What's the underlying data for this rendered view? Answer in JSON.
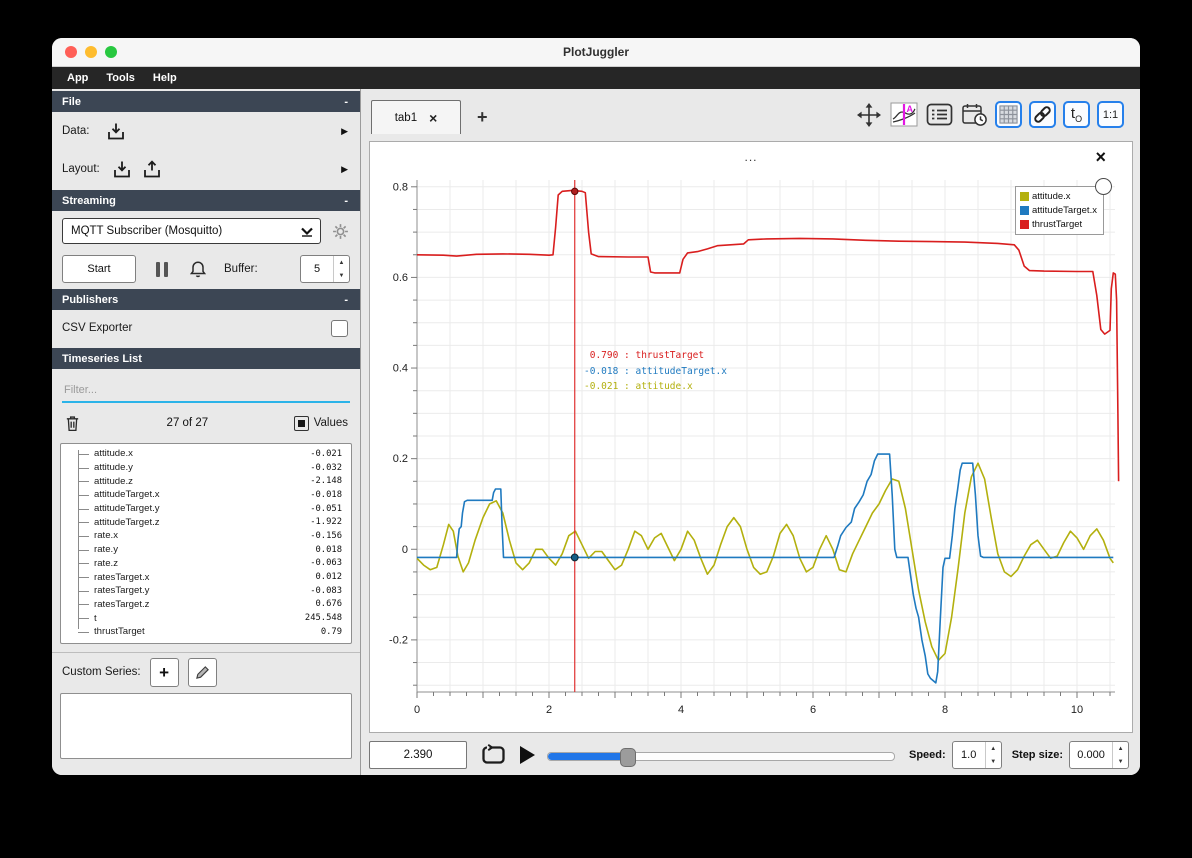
{
  "window": {
    "title": "PlotJuggler"
  },
  "menu": {
    "items": [
      "App",
      "Tools",
      "Help"
    ]
  },
  "sidebar": {
    "file": {
      "title": "File",
      "collapse": "-",
      "data_label": "Data:",
      "layout_label": "Layout:"
    },
    "streaming": {
      "title": "Streaming",
      "collapse": "-",
      "plugin_selected": "MQTT Subscriber (Mosquitto)",
      "start_button": "Start",
      "buffer_label": "Buffer:",
      "buffer_value": "5"
    },
    "publishers": {
      "title": "Publishers",
      "collapse": "-",
      "csv_exporter_label": "CSV Exporter"
    },
    "timeseries": {
      "title": "Timeseries List",
      "filter_placeholder": "Filter...",
      "count_text": "27 of 27",
      "values_label": "Values",
      "items": [
        {
          "name": "attitude.x",
          "value": "-0.021"
        },
        {
          "name": "attitude.y",
          "value": "-0.032"
        },
        {
          "name": "attitude.z",
          "value": "-2.148"
        },
        {
          "name": "attitudeTarget.x",
          "value": "-0.018"
        },
        {
          "name": "attitudeTarget.y",
          "value": "-0.051"
        },
        {
          "name": "attitudeTarget.z",
          "value": "-1.922"
        },
        {
          "name": "rate.x",
          "value": "-0.156"
        },
        {
          "name": "rate.y",
          "value": "0.018"
        },
        {
          "name": "rate.z",
          "value": "-0.063"
        },
        {
          "name": "ratesTarget.x",
          "value": "0.012"
        },
        {
          "name": "ratesTarget.y",
          "value": "-0.083"
        },
        {
          "name": "ratesTarget.z",
          "value": "0.676"
        },
        {
          "name": "t",
          "value": "245.548"
        },
        {
          "name": "thrustTarget",
          "value": "0.79"
        }
      ],
      "custom_series_label": "Custom Series:"
    }
  },
  "tabbar": {
    "active_tab": "tab1",
    "new_tab_label": "+",
    "icons": [
      "pan-zoom-icon",
      "trace-style-icon",
      "legend-list-icon",
      "datetime-icon",
      "grid-layout-icon",
      "link-axes-icon",
      "time-offset-icon",
      "ratio-1-1-icon"
    ],
    "ratio_text": "1:1"
  },
  "plot": {
    "title": "...",
    "tooltip": [
      {
        "value": "0.790",
        "series": "thrustTarget"
      },
      {
        "value": "-0.018",
        "series": "attitudeTarget.x"
      },
      {
        "value": "-0.021",
        "series": "attitude.x"
      }
    ]
  },
  "chart_data": {
    "type": "line",
    "title": "...",
    "xlabel": "",
    "ylabel": "",
    "xlim": [
      0,
      10.6
    ],
    "ylim": [
      -0.315,
      0.815
    ],
    "x_ticks": [
      0,
      2,
      4,
      6,
      8,
      10
    ],
    "y_ticks": [
      -0.2,
      0,
      0.2,
      0.4,
      0.6,
      0.8
    ],
    "grid": true,
    "legend_position": "top-right",
    "cursor": {
      "x": 2.39,
      "points": [
        {
          "series": "thrustTarget",
          "y": 0.79
        },
        {
          "series": "attitudeTarget.x",
          "y": -0.018
        }
      ]
    },
    "series": [
      {
        "name": "attitude.x",
        "color": "#b3b00e",
        "points": [
          [
            0,
            -0.02
          ],
          [
            0.1,
            -0.035
          ],
          [
            0.2,
            -0.045
          ],
          [
            0.3,
            -0.04
          ],
          [
            0.4,
            0.01
          ],
          [
            0.48,
            0.055
          ],
          [
            0.55,
            0.04
          ],
          [
            0.62,
            -0.015
          ],
          [
            0.7,
            -0.05
          ],
          [
            0.78,
            -0.03
          ],
          [
            0.88,
            0.02
          ],
          [
            1.0,
            0.07
          ],
          [
            1.1,
            0.1
          ],
          [
            1.2,
            0.107
          ],
          [
            1.3,
            0.08
          ],
          [
            1.4,
            0.02
          ],
          [
            1.5,
            -0.03
          ],
          [
            1.6,
            -0.045
          ],
          [
            1.7,
            -0.03
          ],
          [
            1.8,
            0.0
          ],
          [
            1.9,
            0.0
          ],
          [
            2.0,
            -0.02
          ],
          [
            2.1,
            -0.035
          ],
          [
            2.2,
            -0.01
          ],
          [
            2.3,
            0.03
          ],
          [
            2.4,
            0.04
          ],
          [
            2.5,
            0.01
          ],
          [
            2.6,
            -0.02
          ],
          [
            2.7,
            -0.005
          ],
          [
            2.8,
            -0.005
          ],
          [
            2.9,
            -0.025
          ],
          [
            3.0,
            -0.045
          ],
          [
            3.1,
            -0.035
          ],
          [
            3.2,
            0.0
          ],
          [
            3.3,
            0.04
          ],
          [
            3.4,
            0.03
          ],
          [
            3.5,
            0.0
          ],
          [
            3.6,
            0.025
          ],
          [
            3.7,
            0.035
          ],
          [
            3.8,
            0.005
          ],
          [
            3.9,
            -0.025
          ],
          [
            4.0,
            0.0
          ],
          [
            4.1,
            0.04
          ],
          [
            4.2,
            0.02
          ],
          [
            4.3,
            -0.02
          ],
          [
            4.4,
            -0.055
          ],
          [
            4.5,
            -0.035
          ],
          [
            4.6,
            0.01
          ],
          [
            4.7,
            0.05
          ],
          [
            4.8,
            0.07
          ],
          [
            4.9,
            0.05
          ],
          [
            5.0,
            0.0
          ],
          [
            5.1,
            -0.04
          ],
          [
            5.2,
            -0.055
          ],
          [
            5.3,
            -0.05
          ],
          [
            5.4,
            -0.015
          ],
          [
            5.5,
            0.035
          ],
          [
            5.6,
            0.055
          ],
          [
            5.7,
            0.03
          ],
          [
            5.8,
            -0.02
          ],
          [
            5.9,
            -0.05
          ],
          [
            6.0,
            -0.04
          ],
          [
            6.1,
            0.0
          ],
          [
            6.2,
            0.03
          ],
          [
            6.3,
            0.0
          ],
          [
            6.4,
            -0.045
          ],
          [
            6.5,
            -0.05
          ],
          [
            6.6,
            -0.01
          ],
          [
            6.7,
            0.02
          ],
          [
            6.8,
            0.05
          ],
          [
            6.9,
            0.08
          ],
          [
            7.0,
            0.1
          ],
          [
            7.1,
            0.13
          ],
          [
            7.2,
            0.155
          ],
          [
            7.3,
            0.15
          ],
          [
            7.4,
            0.09
          ],
          [
            7.5,
            0.0
          ],
          [
            7.6,
            -0.09
          ],
          [
            7.7,
            -0.16
          ],
          [
            7.8,
            -0.215
          ],
          [
            7.9,
            -0.245
          ],
          [
            8.0,
            -0.23
          ],
          [
            8.1,
            -0.15
          ],
          [
            8.2,
            -0.04
          ],
          [
            8.3,
            0.08
          ],
          [
            8.4,
            0.16
          ],
          [
            8.5,
            0.19
          ],
          [
            8.6,
            0.155
          ],
          [
            8.7,
            0.07
          ],
          [
            8.8,
            -0.01
          ],
          [
            8.9,
            -0.05
          ],
          [
            9.0,
            -0.06
          ],
          [
            9.1,
            -0.045
          ],
          [
            9.2,
            -0.015
          ],
          [
            9.3,
            0.01
          ],
          [
            9.4,
            0.02
          ],
          [
            9.5,
            0.0
          ],
          [
            9.6,
            -0.02
          ],
          [
            9.7,
            -0.015
          ],
          [
            9.8,
            0.015
          ],
          [
            9.9,
            0.04
          ],
          [
            10.0,
            0.025
          ],
          [
            10.1,
            0.0
          ],
          [
            10.2,
            0.03
          ],
          [
            10.3,
            0.045
          ],
          [
            10.4,
            0.02
          ],
          [
            10.5,
            -0.02
          ],
          [
            10.55,
            -0.03
          ]
        ]
      },
      {
        "name": "attitudeTarget.x",
        "color": "#1f7ac0",
        "points": [
          [
            0,
            -0.018
          ],
          [
            0.6,
            -0.018
          ],
          [
            0.62,
            0.02
          ],
          [
            0.64,
            0.045
          ],
          [
            0.67,
            0.05
          ],
          [
            0.69,
            0.08
          ],
          [
            0.72,
            0.105
          ],
          [
            0.76,
            0.108
          ],
          [
            1.14,
            0.108
          ],
          [
            1.16,
            0.125
          ],
          [
            1.19,
            0.133
          ],
          [
            1.27,
            0.133
          ],
          [
            1.29,
            0.05
          ],
          [
            1.31,
            -0.018
          ],
          [
            6.32,
            -0.018
          ],
          [
            6.38,
            0.01
          ],
          [
            6.42,
            0.03
          ],
          [
            6.5,
            0.048
          ],
          [
            6.58,
            0.06
          ],
          [
            6.63,
            0.09
          ],
          [
            6.7,
            0.105
          ],
          [
            6.76,
            0.12
          ],
          [
            6.82,
            0.15
          ],
          [
            6.88,
            0.165
          ],
          [
            6.93,
            0.195
          ],
          [
            6.98,
            0.21
          ],
          [
            7.16,
            0.21
          ],
          [
            7.2,
            0.12
          ],
          [
            7.24,
            0.0
          ],
          [
            7.27,
            -0.018
          ],
          [
            7.44,
            -0.018
          ],
          [
            7.48,
            -0.06
          ],
          [
            7.52,
            -0.1
          ],
          [
            7.56,
            -0.13
          ],
          [
            7.6,
            -0.15
          ],
          [
            7.65,
            -0.2
          ],
          [
            7.7,
            -0.235
          ],
          [
            7.74,
            -0.275
          ],
          [
            7.78,
            -0.285
          ],
          [
            7.86,
            -0.295
          ],
          [
            7.89,
            -0.27
          ],
          [
            7.93,
            -0.15
          ],
          [
            7.97,
            -0.04
          ],
          [
            8.0,
            -0.02
          ],
          [
            8.07,
            -0.02
          ],
          [
            8.11,
            0.03
          ],
          [
            8.15,
            0.09
          ],
          [
            8.19,
            0.13
          ],
          [
            8.23,
            0.175
          ],
          [
            8.26,
            0.19
          ],
          [
            8.42,
            0.19
          ],
          [
            8.46,
            0.12
          ],
          [
            8.5,
            0.03
          ],
          [
            8.54,
            -0.015
          ],
          [
            8.58,
            -0.018
          ],
          [
            10.55,
            -0.018
          ]
        ]
      },
      {
        "name": "thrustTarget",
        "color": "#d91e1e",
        "points": [
          [
            0,
            0.65
          ],
          [
            0.4,
            0.649
          ],
          [
            0.6,
            0.647
          ],
          [
            0.9,
            0.651
          ],
          [
            1.3,
            0.652
          ],
          [
            1.7,
            0.651
          ],
          [
            2.0,
            0.649
          ],
          [
            2.06,
            0.65
          ],
          [
            2.1,
            0.71
          ],
          [
            2.14,
            0.782
          ],
          [
            2.2,
            0.79
          ],
          [
            2.35,
            0.792
          ],
          [
            2.5,
            0.79
          ],
          [
            2.55,
            0.787
          ],
          [
            2.6,
            0.7
          ],
          [
            2.64,
            0.652
          ],
          [
            2.75,
            0.646
          ],
          [
            3.2,
            0.645
          ],
          [
            3.5,
            0.645
          ],
          [
            3.54,
            0.612
          ],
          [
            3.6,
            0.61
          ],
          [
            3.98,
            0.61
          ],
          [
            4.03,
            0.64
          ],
          [
            4.1,
            0.654
          ],
          [
            4.25,
            0.657
          ],
          [
            4.4,
            0.663
          ],
          [
            4.55,
            0.67
          ],
          [
            4.75,
            0.672
          ],
          [
            4.95,
            0.674
          ],
          [
            5.02,
            0.683
          ],
          [
            5.3,
            0.685
          ],
          [
            5.8,
            0.686
          ],
          [
            6.3,
            0.685
          ],
          [
            6.8,
            0.682
          ],
          [
            7.3,
            0.68
          ],
          [
            7.8,
            0.679
          ],
          [
            8.3,
            0.678
          ],
          [
            8.8,
            0.675
          ],
          [
            9.05,
            0.672
          ],
          [
            9.12,
            0.66
          ],
          [
            9.2,
            0.625
          ],
          [
            9.28,
            0.615
          ],
          [
            9.5,
            0.614
          ],
          [
            10.0,
            0.613
          ],
          [
            10.24,
            0.613
          ],
          [
            10.3,
            0.56
          ],
          [
            10.36,
            0.485
          ],
          [
            10.42,
            0.475
          ],
          [
            10.5,
            0.483
          ],
          [
            10.52,
            0.575
          ],
          [
            10.55,
            0.61
          ],
          [
            10.58,
            0.607
          ],
          [
            10.6,
            0.55
          ],
          [
            10.62,
            0.3
          ],
          [
            10.63,
            0.15
          ]
        ]
      }
    ]
  },
  "playbar": {
    "time_value": "2.390",
    "speed_label": "Speed:",
    "speed_value": "1.0",
    "step_label": "Step size:",
    "step_value": "0.000"
  },
  "colors": {
    "accent_blue": "#2680eb",
    "filter_underline": "#2bb3e8",
    "slider_fill": "#2176e8",
    "cursor_red": "#e03131",
    "header_slate": "#3c4654"
  }
}
